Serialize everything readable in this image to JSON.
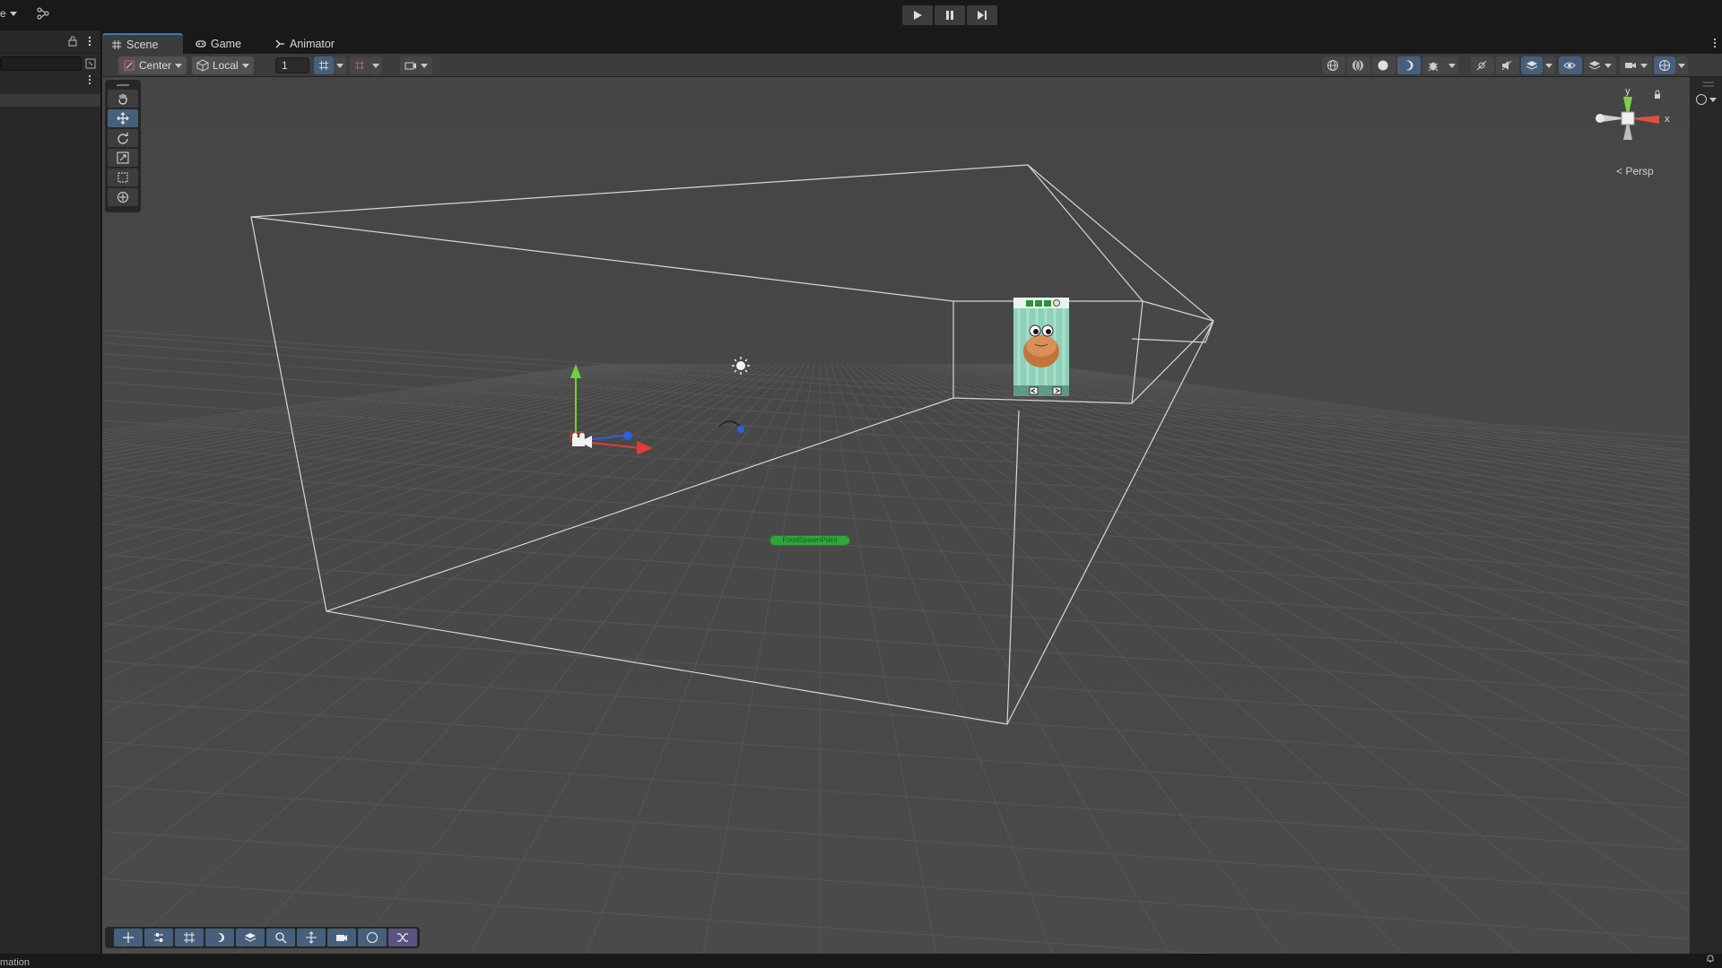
{
  "topbar": {
    "left_dropdown_label": "e",
    "play_icon": "play-icon",
    "pause_icon": "pause-icon",
    "step_icon": "step-icon"
  },
  "tabs": [
    {
      "label": "Scene",
      "icon": "hash-icon",
      "active": true
    },
    {
      "label": "Game",
      "icon": "gamepad-icon",
      "active": false
    },
    {
      "label": "Animator",
      "icon": "animator-icon",
      "active": false
    }
  ],
  "toolbar": {
    "pivot_label": "Center",
    "space_label": "Local",
    "grid_increment": "1"
  },
  "viewport": {
    "projection_label": "Persp",
    "axis_y": "y",
    "axis_x": "x",
    "spawn_point_label": "FoodSpawnPoint",
    "background_color": "#474747",
    "grid_color": "#5a5a5a"
  },
  "statusbar": {
    "left_text": "mation"
  },
  "colors": {
    "accent_blue": "#46607c",
    "tab_accent": "#3a79bb",
    "spawn_green": "#2fa63a"
  }
}
